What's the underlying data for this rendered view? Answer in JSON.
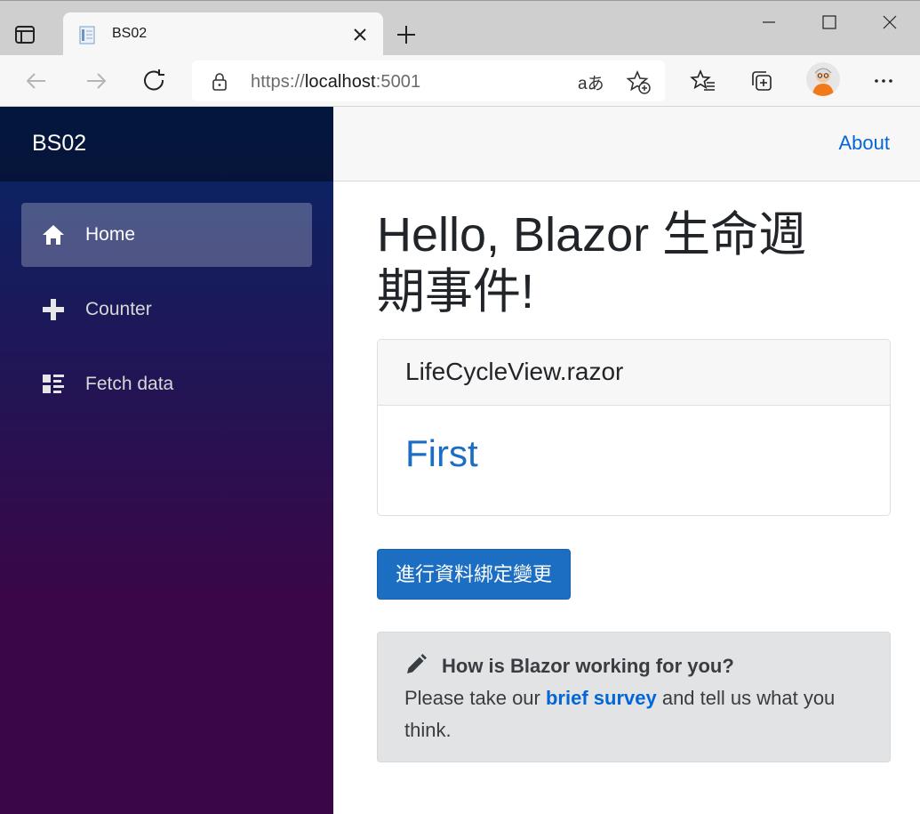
{
  "browser": {
    "tab_title": "BS02",
    "url_prefix": "https://",
    "url_host": "localhost",
    "url_port": ":5001",
    "read_aloud_label": "aあ"
  },
  "app": {
    "brand": "BS02",
    "top_link": "About",
    "nav": [
      {
        "label": "Home",
        "icon": "home-icon",
        "active": true
      },
      {
        "label": "Counter",
        "icon": "plus-icon",
        "active": false
      },
      {
        "label": "Fetch data",
        "icon": "list-rich-icon",
        "active": false
      }
    ]
  },
  "main": {
    "title_line1": "Hello, Blazor 生命週",
    "title_line2": "期事件!",
    "card_header": "LifeCycleView.razor",
    "card_value": "First",
    "button_label": "進行資料綁定變更",
    "survey": {
      "heading": "How is Blazor working for you?",
      "text_before": "Please take our ",
      "link_text": "brief survey",
      "text_after": " and tell us what you think."
    }
  },
  "colors": {
    "accent": "#1b6ec2",
    "link": "#0366d6",
    "sidebar_top": "#052767",
    "sidebar_bottom": "#3a0647"
  }
}
